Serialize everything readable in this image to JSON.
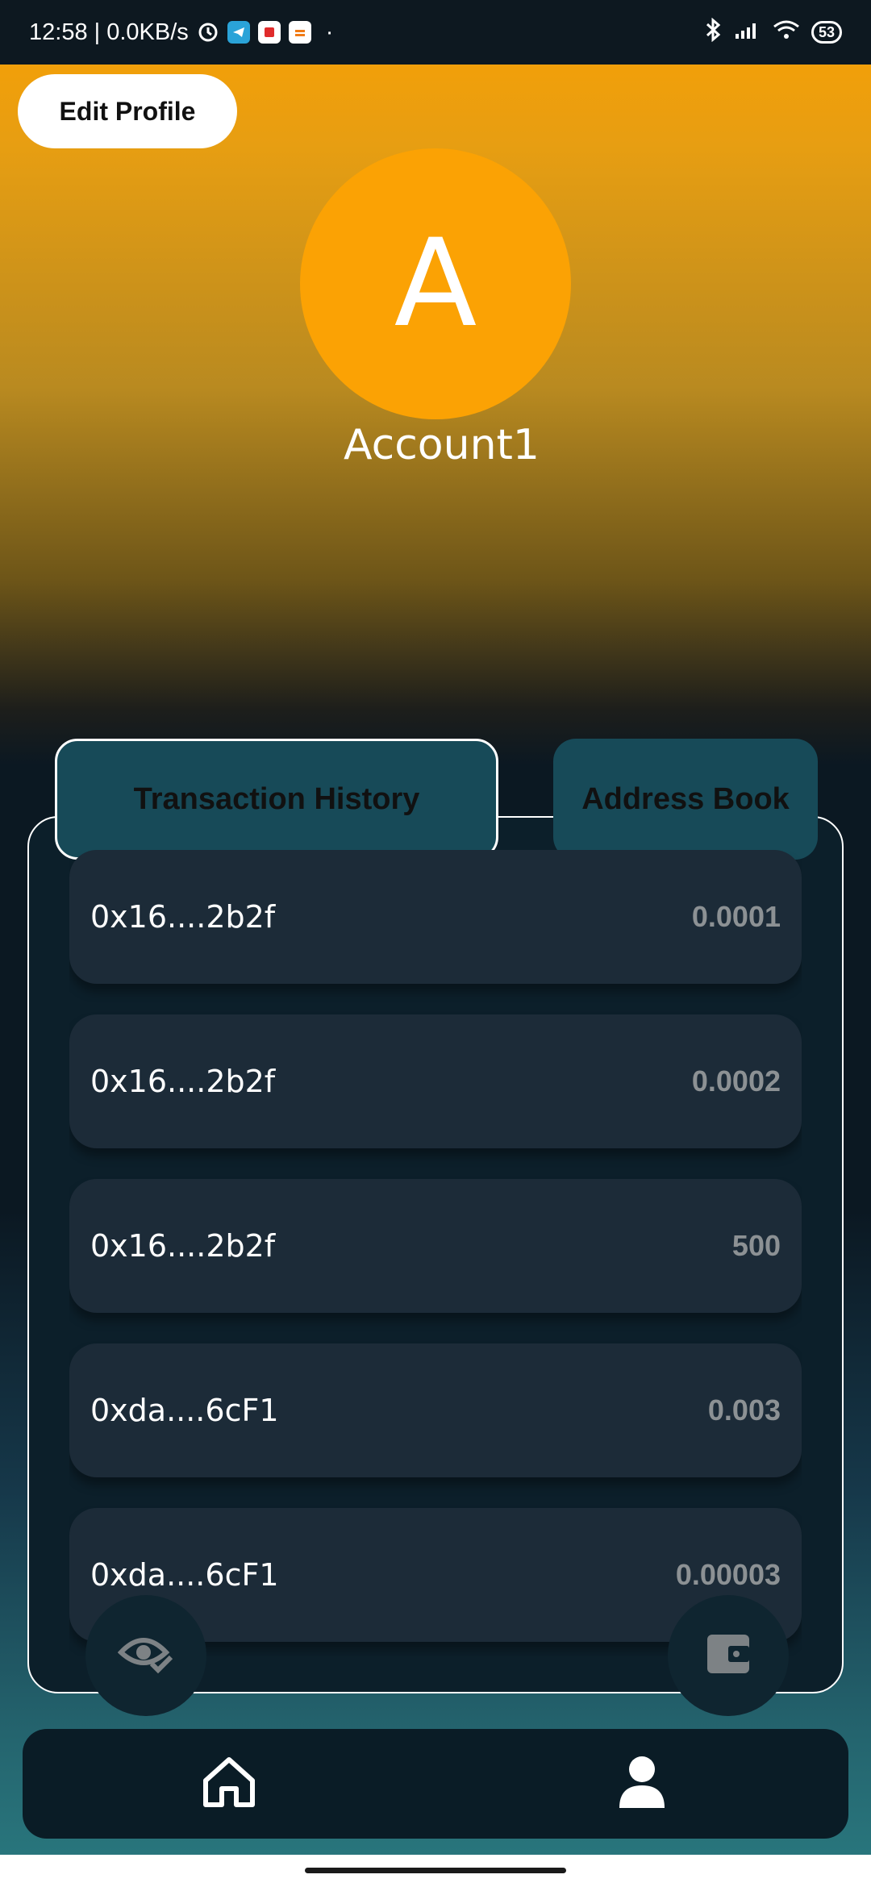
{
  "status_bar": {
    "time_speed": "12:58 | 0.0KB/s",
    "battery": "53",
    "dot": "·"
  },
  "profile": {
    "edit_label": "Edit Profile",
    "avatar_letter": "A",
    "account_name": "Account1"
  },
  "tabs": {
    "history_label": "Transaction History",
    "address_label": "Address Book"
  },
  "transactions": [
    {
      "address": "0x16....2b2f",
      "amount": "0.0001"
    },
    {
      "address": "0x16....2b2f",
      "amount": "0.0002"
    },
    {
      "address": "0x16....2b2f",
      "amount": "500"
    },
    {
      "address": "0xda....6cF1",
      "amount": "0.003"
    },
    {
      "address": "0xda....6cF1",
      "amount": "0.00003"
    }
  ],
  "fabs": {
    "left_icon": "eye-check-icon",
    "right_icon": "wallet-icon"
  },
  "bottom_nav": {
    "items": [
      "home-icon",
      "user-icon"
    ]
  },
  "colors": {
    "accent": "#fba204",
    "tab": "#174a58",
    "card": "#1c2b38",
    "panel": "#0c1f2a"
  }
}
